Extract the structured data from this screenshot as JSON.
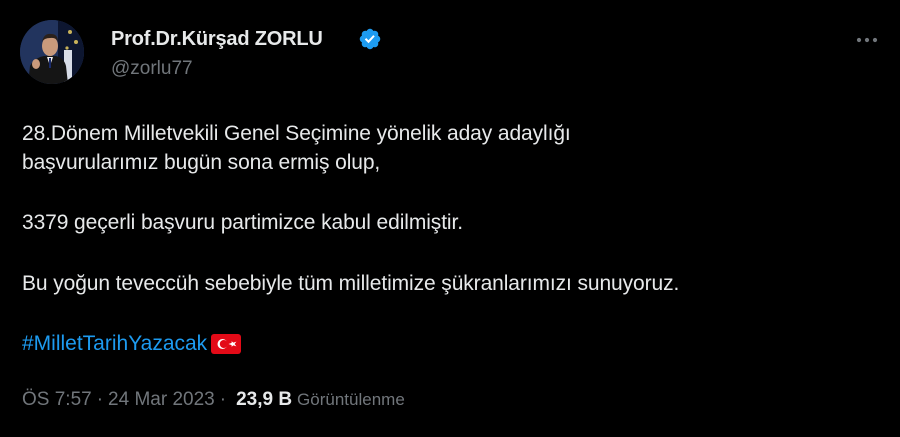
{
  "author": {
    "name": "Prof.Dr.Kürşad ZORLU",
    "handle": "@zorlu77",
    "verified": true
  },
  "tweet": {
    "lines": [
      "28.Dönem Milletvekili Genel Seçimine yönelik aday adaylığı",
      "başvurularımız bugün sona ermiş olup,",
      "3379 geçerli başvuru partimizce kabul edilmiştir.",
      "Bu yoğun teveccüh sebebiyle tüm milletimize şükranlarımızı sunuyoruz."
    ],
    "hashtag": "#MilletTarihYazacak",
    "flag_emoji": "turkey-flag-icon"
  },
  "meta": {
    "time": "ÖS 7:57",
    "separator": "·",
    "date": "24 Mar 2023",
    "views_count": "23,9 B",
    "views_label": "Görüntülenme"
  },
  "colors": {
    "background": "#000000",
    "text": "#e7e9ea",
    "secondary": "#71767b",
    "accent": "#1d9bf0",
    "flag_red": "#e30a17"
  },
  "icons": {
    "verified": "verified-badge-icon",
    "more": "more-dots-icon"
  }
}
